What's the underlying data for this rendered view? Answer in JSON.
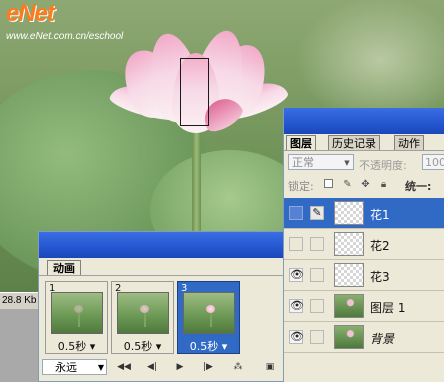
{
  "watermark": {
    "logo": "eNet",
    "url": "www.eNet.com.cn/eschool"
  },
  "status_bar": {
    "file_size": "28.8 Kb"
  },
  "layers_panel": {
    "tabs": [
      {
        "label": "图层"
      },
      {
        "label": "历史记录"
      },
      {
        "label": "动作"
      }
    ],
    "blend_mode": "正常",
    "opacity_label": "不透明度:",
    "opacity_value": "100",
    "lock_label": "锁定:",
    "fill_label": "统一:",
    "layers": [
      {
        "name": "花1",
        "visible": false,
        "selected": true,
        "thumb": "transparent"
      },
      {
        "name": "花2",
        "visible": false,
        "selected": false,
        "thumb": "transparent"
      },
      {
        "name": "花3",
        "visible": true,
        "selected": false,
        "thumb": "transparent"
      },
      {
        "name": "图层 1",
        "visible": true,
        "selected": false,
        "thumb": "photo"
      },
      {
        "name": "背景",
        "visible": true,
        "selected": false,
        "thumb": "photo"
      }
    ]
  },
  "animation_panel": {
    "tab": "动画",
    "frames": [
      {
        "number": "1",
        "delay": "0.5秒",
        "selected": false
      },
      {
        "number": "2",
        "delay": "0.5秒",
        "selected": false
      },
      {
        "number": "3",
        "delay": "0.5秒",
        "selected": true
      }
    ],
    "loop": "永远",
    "controls": [
      "first-frame",
      "previous-frame",
      "play",
      "next-frame",
      "tween",
      "new-frame"
    ]
  },
  "colors": {
    "titlebar": "#2456d0",
    "selection": "#316ac5",
    "panel_bg": "#ece9d8"
  }
}
